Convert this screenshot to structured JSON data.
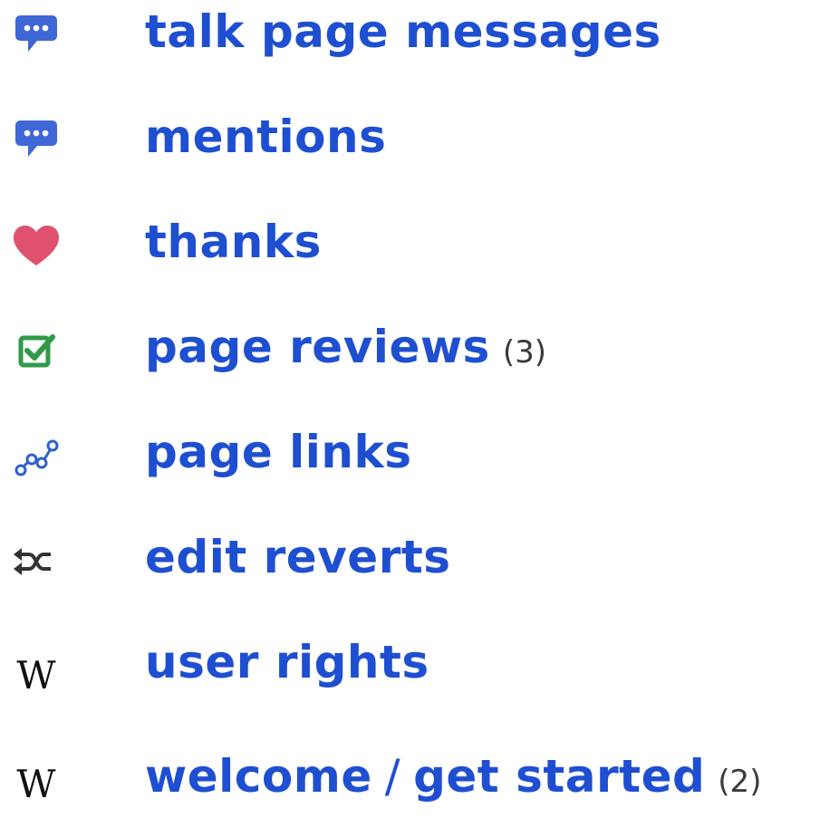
{
  "colors": {
    "link": "#1f4fd1",
    "count": "#3a3a3a",
    "speech_icon": "#3f67d6",
    "heart_icon": "#e0506f",
    "check_icon": "#2f9a47",
    "links_icon": "#2f62c8",
    "revert_icon": "#333333"
  },
  "items": [
    {
      "icon": "speech-bubble-icon",
      "label": "talk page messages"
    },
    {
      "icon": "speech-bubble-icon",
      "label": "mentions"
    },
    {
      "icon": "heart-icon",
      "label": "thanks"
    },
    {
      "icon": "checkbox-icon",
      "label": "page reviews",
      "count": "(3)"
    },
    {
      "icon": "linked-nodes-icon",
      "label": "page links"
    },
    {
      "icon": "shuffle-arrows-icon",
      "label": "edit reverts"
    },
    {
      "icon": "wikipedia-w-icon",
      "glyph": "W",
      "label": "user rights"
    },
    {
      "icon": "wikipedia-w-icon",
      "glyph": "W",
      "label": "welcome",
      "separator": "/",
      "label2": "get started",
      "count": "(2)"
    }
  ]
}
